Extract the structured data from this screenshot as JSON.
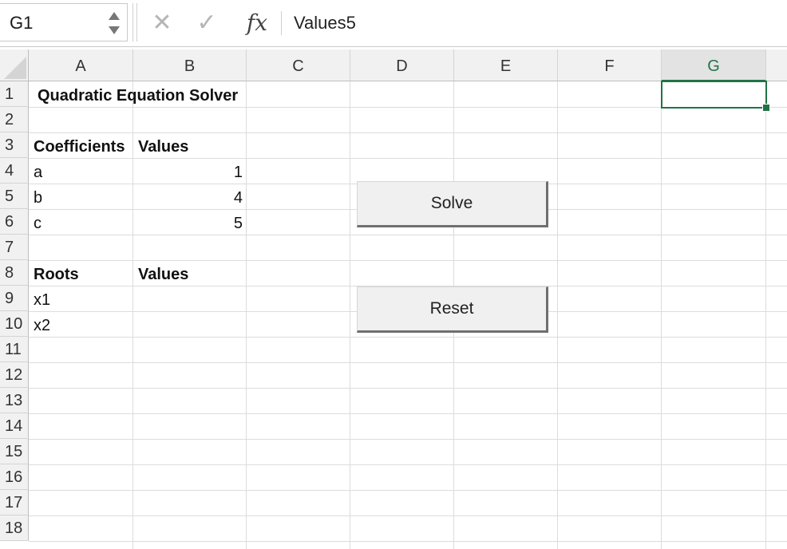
{
  "formula_bar": {
    "name_box": "G1",
    "cancel_glyph": "✕",
    "enter_glyph": "✓",
    "fx_glyph": "fx",
    "content": "Values5"
  },
  "columns": [
    "A",
    "B",
    "C",
    "D",
    "E",
    "F",
    "G"
  ],
  "active_column": "G",
  "rows": [
    "1",
    "2",
    "3",
    "4",
    "5",
    "6",
    "7",
    "8",
    "9",
    "10",
    "11",
    "12",
    "13",
    "14",
    "15",
    "16",
    "17",
    "18"
  ],
  "cells": {
    "A1": "Quadratic Equation Solver",
    "A3": "Coefficients",
    "B3": "Values",
    "A4": "a",
    "B4": "1",
    "A5": "b",
    "B5": "4",
    "A6": "c",
    "B6": "5",
    "A8": "Roots",
    "B8": "Values",
    "A9": "x1",
    "A10": "x2"
  },
  "buttons": {
    "solve": "Solve",
    "reset": "Reset"
  },
  "colors": {
    "selection": "#217346"
  }
}
